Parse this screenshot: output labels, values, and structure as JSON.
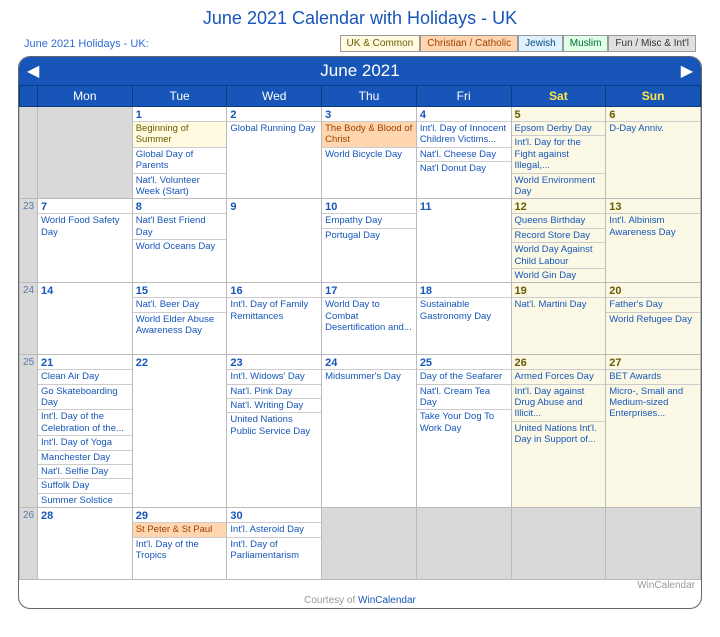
{
  "page_title": "June 2021 Calendar with Holidays - UK",
  "subtitle": "June 2021 Holidays - UK:",
  "legend": {
    "uk": "UK & Common",
    "christian": "Christian / Catholic",
    "jewish": "Jewish",
    "muslim": "Muslim",
    "fun": "Fun / Misc & Int'l"
  },
  "month_label": "June 2021",
  "dow": {
    "mon": "Mon",
    "tue": "Tue",
    "wed": "Wed",
    "thu": "Thu",
    "fri": "Fri",
    "sat": "Sat",
    "sun": "Sun"
  },
  "footer": {
    "text": "Courtesy of",
    "link": "WinCalendar"
  },
  "brand": "WinCalendar",
  "weeks": [
    {
      "wk": "",
      "days": [
        {
          "n": "",
          "wkend": false,
          "empty": true,
          "ev": []
        },
        {
          "n": "1",
          "wkend": false,
          "ev": [
            {
              "t": "Beginning of Summer",
              "cls": "uk"
            },
            {
              "t": "Global Day of Parents",
              "cls": ""
            },
            {
              "t": "Nat'l. Volunteer Week (Start)",
              "cls": ""
            }
          ]
        },
        {
          "n": "2",
          "wkend": false,
          "ev": [
            {
              "t": "Global Running Day",
              "cls": ""
            }
          ]
        },
        {
          "n": "3",
          "wkend": false,
          "ev": [
            {
              "t": "The Body & Blood of Christ",
              "cls": "ch"
            },
            {
              "t": "World Bicycle Day",
              "cls": ""
            }
          ]
        },
        {
          "n": "4",
          "wkend": false,
          "ev": [
            {
              "t": "Int'l. Day of Innocent Children Victims...",
              "cls": ""
            },
            {
              "t": "Nat'l. Cheese Day",
              "cls": ""
            },
            {
              "t": "Nat'l Donut Day",
              "cls": ""
            }
          ]
        },
        {
          "n": "5",
          "wkend": true,
          "ev": [
            {
              "t": "Epsom Derby Day",
              "cls": ""
            },
            {
              "t": "Int'l. Day for the Fight against Illegal,...",
              "cls": ""
            },
            {
              "t": "World Environment Day",
              "cls": ""
            }
          ]
        },
        {
          "n": "6",
          "wkend": true,
          "ev": [
            {
              "t": "D-Day Anniv.",
              "cls": ""
            }
          ]
        }
      ]
    },
    {
      "wk": "23",
      "days": [
        {
          "n": "7",
          "wkend": false,
          "ev": [
            {
              "t": "World Food Safety Day",
              "cls": ""
            }
          ]
        },
        {
          "n": "8",
          "wkend": false,
          "ev": [
            {
              "t": "Nat'l Best Friend Day",
              "cls": ""
            },
            {
              "t": "World Oceans Day",
              "cls": ""
            }
          ]
        },
        {
          "n": "9",
          "wkend": false,
          "ev": []
        },
        {
          "n": "10",
          "wkend": false,
          "ev": [
            {
              "t": "Empathy Day",
              "cls": ""
            },
            {
              "t": "Portugal Day",
              "cls": ""
            }
          ]
        },
        {
          "n": "11",
          "wkend": false,
          "ev": []
        },
        {
          "n": "12",
          "wkend": true,
          "ev": [
            {
              "t": "Queens Birthday",
              "cls": ""
            },
            {
              "t": "Record Store Day",
              "cls": ""
            },
            {
              "t": "World Day Against Child Labour",
              "cls": ""
            },
            {
              "t": "World Gin Day",
              "cls": ""
            }
          ]
        },
        {
          "n": "13",
          "wkend": true,
          "ev": [
            {
              "t": "Int'l. Albinism Awareness Day",
              "cls": ""
            }
          ]
        }
      ]
    },
    {
      "wk": "24",
      "days": [
        {
          "n": "14",
          "wkend": false,
          "ev": []
        },
        {
          "n": "15",
          "wkend": false,
          "ev": [
            {
              "t": "Nat'l. Beer Day",
              "cls": ""
            },
            {
              "t": "World Elder Abuse Awareness Day",
              "cls": ""
            }
          ]
        },
        {
          "n": "16",
          "wkend": false,
          "ev": [
            {
              "t": "Int'l. Day of Family Remittances",
              "cls": ""
            }
          ]
        },
        {
          "n": "17",
          "wkend": false,
          "ev": [
            {
              "t": "World Day to Combat Desertification and...",
              "cls": ""
            }
          ]
        },
        {
          "n": "18",
          "wkend": false,
          "ev": [
            {
              "t": "Sustainable Gastronomy Day",
              "cls": ""
            }
          ]
        },
        {
          "n": "19",
          "wkend": true,
          "ev": [
            {
              "t": "Nat'l. Martini Day",
              "cls": ""
            }
          ]
        },
        {
          "n": "20",
          "wkend": true,
          "ev": [
            {
              "t": "Father's Day",
              "cls": ""
            },
            {
              "t": "World Refugee Day",
              "cls": ""
            }
          ]
        }
      ]
    },
    {
      "wk": "25",
      "days": [
        {
          "n": "21",
          "wkend": false,
          "ev": [
            {
              "t": "Clean Air Day",
              "cls": ""
            },
            {
              "t": "Go Skateboarding Day",
              "cls": ""
            },
            {
              "t": "Int'l. Day of the Celebration of the...",
              "cls": ""
            },
            {
              "t": "Int'l. Day of Yoga",
              "cls": ""
            },
            {
              "t": "Manchester Day",
              "cls": ""
            },
            {
              "t": "Nat'l. Selfie Day",
              "cls": ""
            },
            {
              "t": "Suffolk Day",
              "cls": ""
            },
            {
              "t": "Summer Solstice",
              "cls": ""
            }
          ]
        },
        {
          "n": "22",
          "wkend": false,
          "ev": []
        },
        {
          "n": "23",
          "wkend": false,
          "ev": [
            {
              "t": "Int'l. Widows' Day",
              "cls": ""
            },
            {
              "t": "Nat'l. Pink Day",
              "cls": ""
            },
            {
              "t": "Nat'l. Writing Day",
              "cls": ""
            },
            {
              "t": "United Nations Public Service Day",
              "cls": ""
            }
          ]
        },
        {
          "n": "24",
          "wkend": false,
          "ev": [
            {
              "t": "Midsummer's Day",
              "cls": ""
            }
          ]
        },
        {
          "n": "25",
          "wkend": false,
          "ev": [
            {
              "t": "Day of the Seafarer",
              "cls": ""
            },
            {
              "t": "Nat'l. Cream Tea Day",
              "cls": ""
            },
            {
              "t": "Take Your Dog To Work Day",
              "cls": ""
            }
          ]
        },
        {
          "n": "26",
          "wkend": true,
          "ev": [
            {
              "t": "Armed Forces Day",
              "cls": ""
            },
            {
              "t": "Int'l. Day against Drug Abuse and Illicit...",
              "cls": ""
            },
            {
              "t": "United Nations Int'l. Day in Support of...",
              "cls": ""
            }
          ]
        },
        {
          "n": "27",
          "wkend": true,
          "ev": [
            {
              "t": "BET Awards",
              "cls": ""
            },
            {
              "t": "Micro-, Small and Medium-sized Enterprises...",
              "cls": ""
            }
          ]
        }
      ]
    },
    {
      "wk": "26",
      "days": [
        {
          "n": "28",
          "wkend": false,
          "ev": []
        },
        {
          "n": "29",
          "wkend": false,
          "ev": [
            {
              "t": "St Peter & St Paul",
              "cls": "ch"
            },
            {
              "t": "Int'l. Day of the Tropics",
              "cls": ""
            }
          ]
        },
        {
          "n": "30",
          "wkend": false,
          "ev": [
            {
              "t": "Int'l. Asteroid Day",
              "cls": ""
            },
            {
              "t": "Int'l. Day of Parliamentarism",
              "cls": ""
            }
          ]
        },
        {
          "n": "",
          "wkend": false,
          "empty": true,
          "ev": []
        },
        {
          "n": "",
          "wkend": false,
          "empty": true,
          "ev": []
        },
        {
          "n": "",
          "wkend": true,
          "empty": true,
          "ev": []
        },
        {
          "n": "",
          "wkend": true,
          "empty": true,
          "ev": []
        }
      ]
    }
  ]
}
